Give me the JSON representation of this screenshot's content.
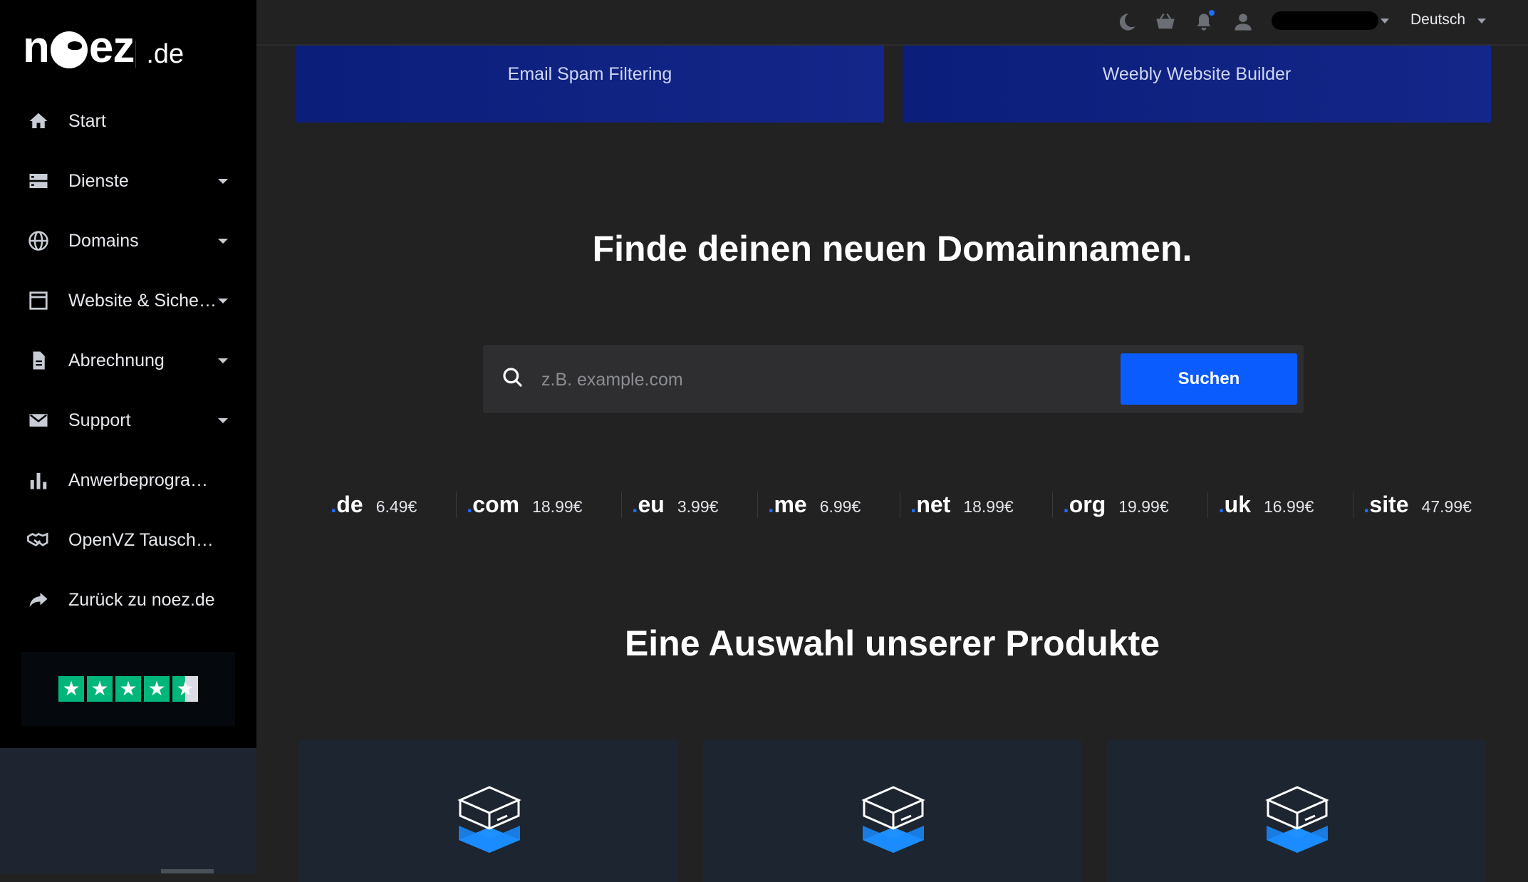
{
  "logo": {
    "prefix": "n",
    "suffix": "ez",
    "tld": ".de"
  },
  "sidebar": {
    "items": [
      {
        "label": "Start",
        "icon": "home-icon",
        "has_caret": false
      },
      {
        "label": "Dienste",
        "icon": "server-icon",
        "has_caret": true
      },
      {
        "label": "Domains",
        "icon": "globe-icon",
        "has_caret": true
      },
      {
        "label": "Website & Sicherheit",
        "icon": "browser-window-icon",
        "has_caret": true
      },
      {
        "label": "Abrechnung",
        "icon": "invoice-icon",
        "has_caret": true
      },
      {
        "label": "Support",
        "icon": "mail-icon",
        "has_caret": true
      },
      {
        "label": "Anwerbeprogramm",
        "icon": "bar-chart-icon",
        "has_caret": false
      },
      {
        "label": "OpenVZ Tauschprogramm",
        "icon": "handshake-icon",
        "has_caret": false
      },
      {
        "label": "Zurück zu noez.de",
        "icon": "share-arrow-icon",
        "has_caret": false
      }
    ],
    "trustpilot_rating": 4.5
  },
  "topbar": {
    "language": "Deutsch",
    "icons": [
      "moon-icon",
      "basket-icon",
      "bell-icon",
      "user-icon"
    ]
  },
  "promos": [
    {
      "label": "Email Spam Filtering"
    },
    {
      "label": "Weebly Website Builder"
    }
  ],
  "domain_search": {
    "title": "Finde deinen neuen Domainnamen.",
    "placeholder": "z.B. example.com",
    "button_label": "Suchen"
  },
  "tlds": [
    {
      "name": "de",
      "price": "6.49€"
    },
    {
      "name": "com",
      "price": "18.99€"
    },
    {
      "name": "eu",
      "price": "3.99€"
    },
    {
      "name": "me",
      "price": "6.99€"
    },
    {
      "name": "net",
      "price": "18.99€"
    },
    {
      "name": "org",
      "price": "19.99€"
    },
    {
      "name": "uk",
      "price": "16.99€"
    },
    {
      "name": "site",
      "price": "47.99€"
    }
  ],
  "products": {
    "title": "Eine Auswahl unserer Produkte",
    "cards": [
      {
        "icon": "server-box-icon"
      },
      {
        "icon": "server-box-icon"
      },
      {
        "icon": "server-box-icon"
      }
    ]
  },
  "colors": {
    "accent": "#0b5cff",
    "sidebar_bg": "#000000",
    "main_bg": "#222222",
    "card_bg": "#1d2530",
    "promo_bg": "#0b1e7a",
    "trustpilot_green": "#00b67a"
  }
}
